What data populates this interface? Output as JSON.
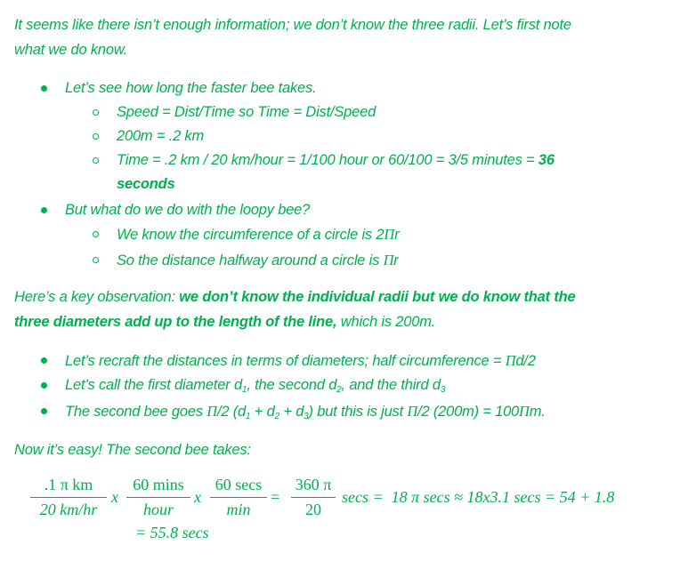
{
  "theme": {
    "text_color": "#00B050"
  },
  "intro": {
    "line1": "It seems like there isn’t enough information; we don’t know the three radii. Let’s first note",
    "line2": "what we do know."
  },
  "bullets1": [
    {
      "text": "Let’s see how long the faster bee takes.",
      "sub": [
        {
          "text": "Speed = Dist/Time so Time = Dist/Speed"
        },
        {
          "text": "200m = .2 km"
        },
        {
          "text": "Time = .2 km / 20 km/hour = 1/100 hour or 60/100 = 3/5 minutes = ",
          "bold": "36",
          "bold2": "seconds"
        }
      ]
    },
    {
      "text": "But what do we do with the loopy bee?",
      "sub": [
        {
          "text": "We know the circumference of a circle is 2",
          "pi": "Π",
          "after": "r"
        },
        {
          "text": "So the distance halfway around a circle is ",
          "pi": "Π",
          "after": "r"
        }
      ]
    }
  ],
  "observation": {
    "lead": "Here’s a key observation: ",
    "bold1": "we don’t know the individual radii but we do know that the",
    "bold2": "three diameters add up to the length of the line,",
    "tail": " which is 200m."
  },
  "bullets2": [
    {
      "text": "Let’s recraft the distances in terms of diameters; half circumference = ",
      "pi": "Π",
      "after": "d/2"
    },
    {
      "pre": "Let’s call the first diameter d",
      "s1": "1",
      "mid1": ", the second d",
      "s2": "2",
      "mid2": ", and the third d",
      "s3": "3"
    },
    {
      "pre": "The second bee goes ",
      "pi": "Π",
      "a": "/2 (d",
      "s1": "1",
      "b": " + d",
      "s2": "2",
      "c": " + d",
      "s3": "3",
      "d": ") but this is just ",
      "pi2": "Π",
      "e": "/2 (200m) = 100",
      "pi3": "Π",
      "f": "m."
    }
  ],
  "now": "Now it’s easy! The second bee takes:",
  "equation": {
    "f1_num": ".1 π km",
    "f1_den": "20 km/hr",
    "times": "x",
    "f2_num": "60 mins",
    "f2_den": "hour",
    "f3_num": "60 secs",
    "f3_den": "min",
    "eq": "=",
    "f4_num": "360 π",
    "f4_den": "20",
    "rest": "secs =  18 π secs ≈ 18x3.1 secs = 54 + 1.8",
    "line2": "= 55.8 secs"
  }
}
